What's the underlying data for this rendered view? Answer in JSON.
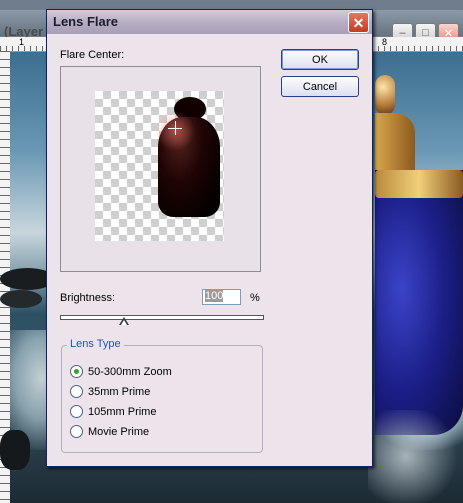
{
  "background": {
    "layer_tab_text": "(Layer",
    "ruler_numbers": [
      "1",
      "8"
    ]
  },
  "dialog": {
    "title": "Lens Flare",
    "flare_center_label": "Flare Center:",
    "ok_label": "OK",
    "cancel_label": "Cancel",
    "brightness_label": "Brightness:",
    "brightness_value": "100",
    "brightness_unit": "%",
    "brightness_slider_fraction": 0.33,
    "lens_type_label": "Lens Type",
    "lens_types": [
      {
        "label": "50-300mm Zoom",
        "selected": true
      },
      {
        "label": "35mm Prime",
        "selected": false
      },
      {
        "label": "105mm Prime",
        "selected": false
      },
      {
        "label": "Movie Prime",
        "selected": false
      }
    ]
  },
  "colors": {
    "legend_blue": "#2052c4",
    "radio_selected": "#2fa12f",
    "close_red": "#c23d22"
  },
  "icons": {
    "close": "close-icon",
    "minimize": "minimize-icon",
    "maximize": "maximize-icon",
    "crosshair": "crosshair-icon"
  }
}
